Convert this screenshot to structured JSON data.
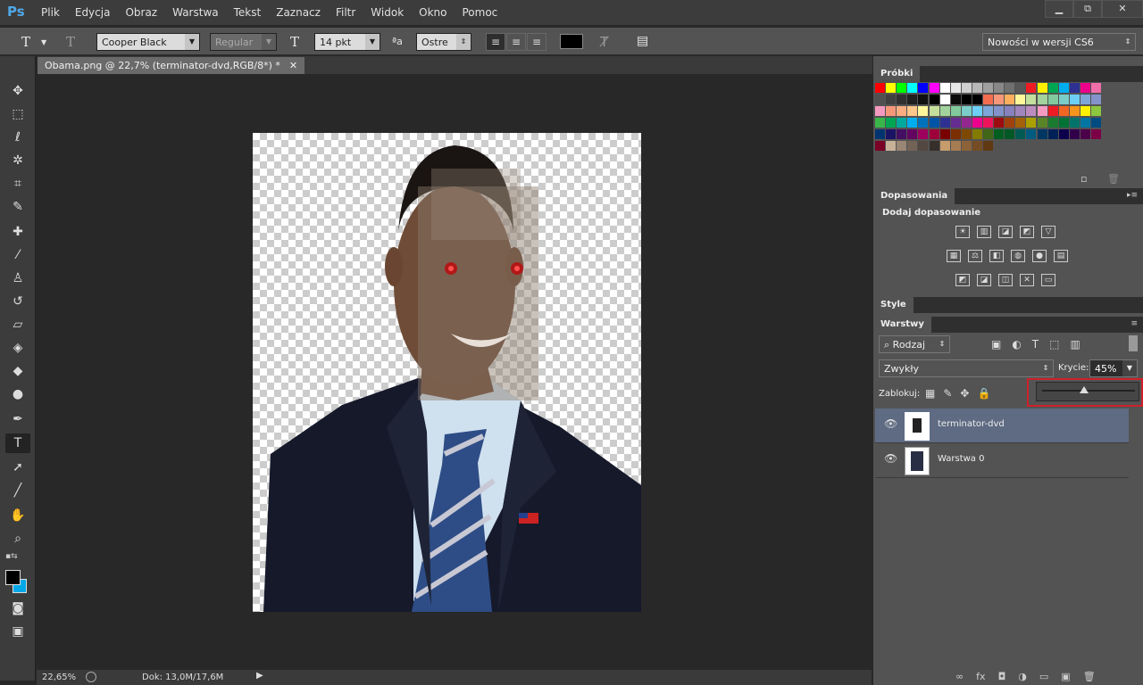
{
  "app": {
    "logo": "Ps",
    "menu": [
      "Plik",
      "Edycja",
      "Obraz",
      "Warstwa",
      "Tekst",
      "Zaznacz",
      "Filtr",
      "Widok",
      "Okno",
      "Pomoc"
    ],
    "window_controls": [
      "▁",
      "⧉",
      "✕"
    ]
  },
  "options": {
    "tool_icon": "T",
    "font_family": "Cooper Black",
    "font_style": "Regular",
    "font_size": "14 pkt",
    "aa_label": "ªa",
    "antialias": "Ostre",
    "color_swatch": "#000000",
    "workspace": "Nowości w wersji CS6"
  },
  "document": {
    "tab_title": "Obama.png @ 22,7% (terminator-dvd,RGB/8*) *",
    "close": "✕"
  },
  "status": {
    "zoom": "22,65%",
    "doc": "Dok: 13,0M/17,6M"
  },
  "panels": {
    "swatches": {
      "title": "Próbki",
      "colors": [
        [
          "#ff0000",
          "#ffff00",
          "#00ff00",
          "#00ffff",
          "#0000ff",
          "#ff00ff",
          "#ffffff",
          "#e8e8e8",
          "#d0d0d0",
          "#b8b8b8",
          "#a0a0a0",
          "#888888",
          "#707070",
          "#585858",
          "#ed1c24",
          "#fff200",
          "#00a651",
          "#00aeef",
          "#2e3192",
          "#ec008c",
          "#f06eaa"
        ],
        [
          "#505050",
          "#404040",
          "#303030",
          "#202020",
          "#101010",
          "#000000",
          "#ffffff",
          "#0a0a0a",
          "#000000",
          "#000000",
          "#f26c4f",
          "#f7977a",
          "#fbaf5d",
          "#fff799",
          "#c4df9b",
          "#a3d39c",
          "#82ca9d",
          "#7bcdc8",
          "#6ecff6",
          "#7ea7d8",
          "#8493ca"
        ],
        [
          "#f49ac1",
          "#f7977a",
          "#f9ad81",
          "#fdc68a",
          "#fff79a",
          "#c4df9b",
          "#a2d39c",
          "#82ca9d",
          "#7bcdc8",
          "#6dcff6",
          "#7da7d9",
          "#8393ca",
          "#8781bd",
          "#a186be",
          "#bd8cbf",
          "#f49ac2",
          "#ed1c24",
          "#f26522",
          "#f7941d",
          "#fff200",
          "#8dc63f"
        ],
        [
          "#39b54a",
          "#00a651",
          "#00a99d",
          "#00aeef",
          "#0072bc",
          "#0054a6",
          "#2e3192",
          "#662d91",
          "#92278f",
          "#ec008c",
          "#ed145b",
          "#9e0b0f",
          "#a0410d",
          "#a36209",
          "#aba000",
          "#598527",
          "#1a7b30",
          "#007236",
          "#00746b",
          "#0076a3",
          "#004b80"
        ],
        [
          "#003471",
          "#1b1464",
          "#440e62",
          "#630460",
          "#9e005d",
          "#9e0039",
          "#790000",
          "#7b2e00",
          "#7d4900",
          "#827b00",
          "#406618",
          "#005e20",
          "#005826",
          "#005952",
          "#005b7f",
          "#003663",
          "#002157",
          "#0d004c",
          "#32004b",
          "#4b0049",
          "#7b0046"
        ],
        [
          "#7a0026",
          "#c7b299",
          "#998675",
          "#736357",
          "#534741",
          "#37302a",
          "#c69c6d",
          "#a67c52",
          "#8c6239",
          "#754c24",
          "#603913"
        ]
      ]
    },
    "adjustments": {
      "title": "Dopasowania",
      "subtitle": "Dodaj dopasowanie",
      "row1": [
        "☀",
        "▥",
        "◪",
        "◩",
        "▽"
      ],
      "row2": [
        "▦",
        "⚖",
        "◧",
        "◍",
        "●",
        "▤"
      ],
      "row3": [
        "◩",
        "◪",
        "◫",
        "✕",
        "▭"
      ]
    },
    "styles": {
      "title": "Style"
    },
    "layers": {
      "title": "Warstwy",
      "filter_kind": "Rodzaj",
      "blend_mode": "Zwykły",
      "opacity_label": "Krycie:",
      "opacity_value": "45%",
      "lock_label": "Zablokuj:",
      "opacity_slider": 0.45,
      "items": [
        {
          "name": "terminator-dvd",
          "visible": "👁",
          "selected": true
        },
        {
          "name": "Warstwa 0",
          "visible": "👁",
          "selected": false
        }
      ],
      "bottom_icons": [
        "∞",
        "fx",
        "◘",
        "◑",
        "▭",
        "▣",
        "🗑"
      ]
    }
  }
}
